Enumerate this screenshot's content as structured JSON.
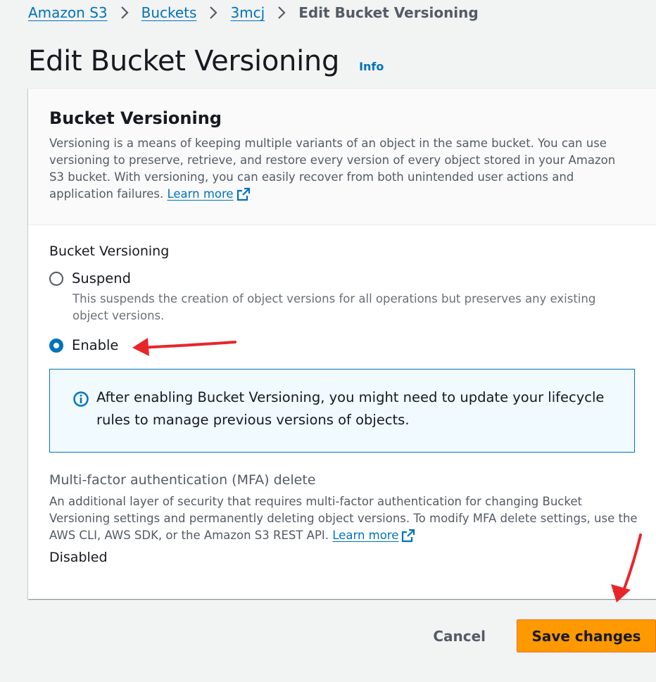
{
  "breadcrumb": {
    "items": [
      {
        "label": "Amazon S3"
      },
      {
        "label": "Buckets"
      },
      {
        "label": "3mcj"
      }
    ],
    "current": "Edit Bucket Versioning"
  },
  "header": {
    "title": "Edit Bucket Versioning",
    "info_label": "Info"
  },
  "panel": {
    "title": "Bucket Versioning",
    "description": "Versioning is a means of keeping multiple variants of an object in the same bucket. You can use versioning to preserve, retrieve, and restore every version of every object stored in your Amazon S3 bucket. With versioning, you can easily recover from both unintended user actions and application failures.",
    "learn_more": "Learn more"
  },
  "versioning": {
    "field_label": "Bucket Versioning",
    "options": [
      {
        "label": "Suspend",
        "description": "This suspends the creation of object versions for all operations but preserves any existing object versions.",
        "selected": false
      },
      {
        "label": "Enable",
        "selected": true
      }
    ],
    "alert_text": "After enabling Bucket Versioning, you might need to update your lifecycle rules to manage previous versions of objects."
  },
  "mfa": {
    "title": "Multi-factor authentication (MFA) delete",
    "description": "An additional layer of security that requires multi-factor authentication for changing Bucket Versioning settings and permanently deleting object versions. To modify MFA delete settings, use the AWS CLI, AWS SDK, or the Amazon S3 REST API.",
    "learn_more": "Learn more",
    "status": "Disabled"
  },
  "actions": {
    "cancel_label": "Cancel",
    "save_label": "Save changes"
  },
  "colors": {
    "link": "#0073bb",
    "primary_button": "#ff9900",
    "annotation_arrow": "#e8262a"
  },
  "icons": [
    "chevron-right-icon",
    "external-link-icon",
    "info-circle-icon",
    "annotation-arrow"
  ]
}
